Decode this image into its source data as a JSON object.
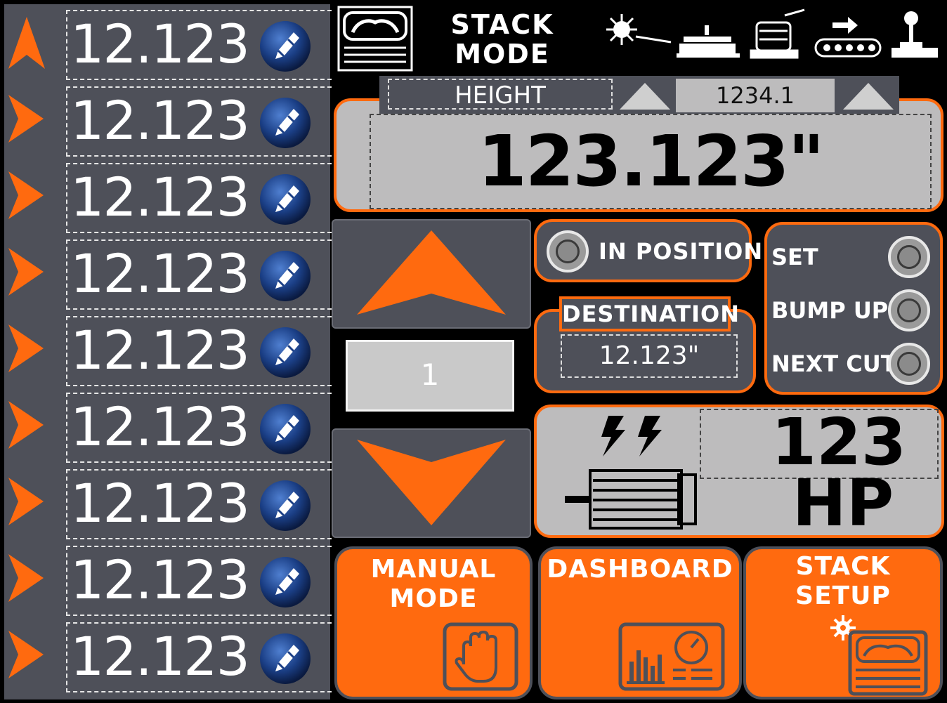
{
  "header": {
    "title_line1": "STACK",
    "title_line2": "MODE",
    "icons": [
      "stack-mode-icon",
      "laser-icon",
      "bed-icon",
      "spool-icon",
      "conveyor-icon",
      "joystick-icon"
    ]
  },
  "steps": [
    {
      "value": "12.123",
      "active": true
    },
    {
      "value": "12.123",
      "active": false
    },
    {
      "value": "12.123",
      "active": false
    },
    {
      "value": "12.123",
      "active": false
    },
    {
      "value": "12.123",
      "active": false
    },
    {
      "value": "12.123",
      "active": false
    },
    {
      "value": "12.123",
      "active": false
    },
    {
      "value": "12.123",
      "active": false
    },
    {
      "value": "12.123",
      "active": false
    }
  ],
  "height": {
    "label": "HEIGHT",
    "setpoint": "1234.1",
    "readout": "123.123\""
  },
  "jog": {
    "step": "1"
  },
  "status": {
    "in_position": "IN POSITION",
    "destination_label": "DESTINATION",
    "destination_value": "12.123\""
  },
  "actions": {
    "set": "SET",
    "bump_up": "BUMP UP",
    "next_cut": "NEXT CUT"
  },
  "motor": {
    "value": "123",
    "unit": "HP"
  },
  "nav": {
    "manual_line1": "MANUAL",
    "manual_line2": "MODE",
    "dashboard": "DASHBOARD",
    "stack_setup_line1": "STACK",
    "stack_setup_line2": "SETUP"
  },
  "colors": {
    "accent": "#ff6a0f",
    "panel": "#4e5059",
    "readout_bg": "#bdbcbd"
  }
}
